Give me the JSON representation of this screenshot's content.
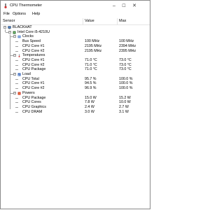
{
  "window": {
    "title": "CPU Thermometer"
  },
  "menu": {
    "file": "File",
    "options": "Options",
    "help": "Help"
  },
  "columns": {
    "sensor": "Sensor",
    "value": "Value",
    "max": "Max"
  },
  "tree": {
    "computer": "BLACKHAT",
    "cpu": "Intel Core i5-4210U",
    "groups": [
      {
        "name": "Clocks",
        "icon": "clock-icon",
        "rows": [
          {
            "sensor": "Bus Speed",
            "value": "100 MHz",
            "max": "100 MHz"
          },
          {
            "sensor": "CPU Core #1",
            "value": "2195 MHz",
            "max": "2394 MHz"
          },
          {
            "sensor": "CPU Core #2",
            "value": "2195 MHz",
            "max": "2395 MHz"
          }
        ]
      },
      {
        "name": "Temperatures",
        "icon": "thermometer-icon",
        "rows": [
          {
            "sensor": "CPU Core #1",
            "value": "71.0 °C",
            "max": "73.0 °C"
          },
          {
            "sensor": "CPU Core #2",
            "value": "71.0 °C",
            "max": "73.0 °C"
          },
          {
            "sensor": "CPU Package",
            "value": "71.0 °C",
            "max": "73.0 °C"
          }
        ]
      },
      {
        "name": "Load",
        "icon": "load-icon",
        "rows": [
          {
            "sensor": "CPU Total",
            "value": "95.7 %",
            "max": "100.0 %"
          },
          {
            "sensor": "CPU Core #1",
            "value": "94.5 %",
            "max": "100.0 %"
          },
          {
            "sensor": "CPU Core #2",
            "value": "96.9 %",
            "max": "100.0 %"
          }
        ]
      },
      {
        "name": "Powers",
        "icon": "power-icon",
        "rows": [
          {
            "sensor": "CPU Package",
            "value": "15.0 W",
            "max": "15.2 W"
          },
          {
            "sensor": "CPU Cores",
            "value": "7.8 W",
            "max": "10.0 W"
          },
          {
            "sensor": "CPU Graphics",
            "value": "2.4 W",
            "max": "2.7 W"
          },
          {
            "sensor": "CPU DRAM",
            "value": "3.0 W",
            "max": "3.1 W"
          }
        ]
      }
    ]
  },
  "colors": {
    "clock": "#3a6fc4",
    "thermometer": "#d03030",
    "load": "#2e5fb8",
    "power": "#d23a2a",
    "chip": "#3c8c3c"
  }
}
